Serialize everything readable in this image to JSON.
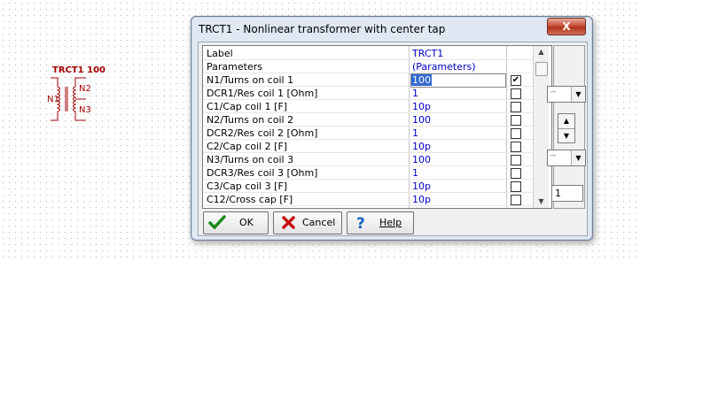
{
  "schematic": {
    "part_title": "TRCT1 100",
    "pin_n1": "N1",
    "pin_n2": "N2",
    "pin_n3": "N3"
  },
  "dialog": {
    "title": "TRCT1 - Nonlinear transformer with center tap",
    "close_label": "X"
  },
  "rows": [
    {
      "name": "Label",
      "value": "TRCT1",
      "checkbox": false,
      "checked": false
    },
    {
      "name": "Parameters",
      "value": "(Parameters)",
      "checkbox": false,
      "checked": false
    },
    {
      "name": "N1/Turns on coil 1",
      "value": "100",
      "checkbox": true,
      "checked": true,
      "editing": true
    },
    {
      "name": "DCR1/Res coil 1 [Ohm]",
      "value": "1",
      "checkbox": true,
      "checked": false
    },
    {
      "name": "C1/Cap coil 1   [F]",
      "value": "10p",
      "checkbox": true,
      "checked": false
    },
    {
      "name": "N2/Turns on coil 2",
      "value": "100",
      "checkbox": true,
      "checked": false
    },
    {
      "name": "DCR2/Res coil 2 [Ohm]",
      "value": "1",
      "checkbox": true,
      "checked": false
    },
    {
      "name": "C2/Cap coil 2   [F]",
      "value": "10p",
      "checkbox": true,
      "checked": false
    },
    {
      "name": "N3/Turns on coil 3",
      "value": "100",
      "checkbox": true,
      "checked": false
    },
    {
      "name": "DCR3/Res coil 3 [Ohm]",
      "value": "1",
      "checkbox": true,
      "checked": false
    },
    {
      "name": "C3/Cap coil 3   [F]",
      "value": "10p",
      "checkbox": true,
      "checked": false
    },
    {
      "name": "C12/Cross cap   [F]",
      "value": "10p",
      "checkbox": true,
      "checked": false
    }
  ],
  "side": {
    "dropdown1": "--",
    "dropdown2": "--",
    "number_value": "1"
  },
  "buttons": {
    "ok": "OK",
    "cancel": "Cancel",
    "help": "Help"
  },
  "colors": {
    "value_text": "#0000c8",
    "selection": "#3168d4",
    "schematic": "#a00000"
  }
}
